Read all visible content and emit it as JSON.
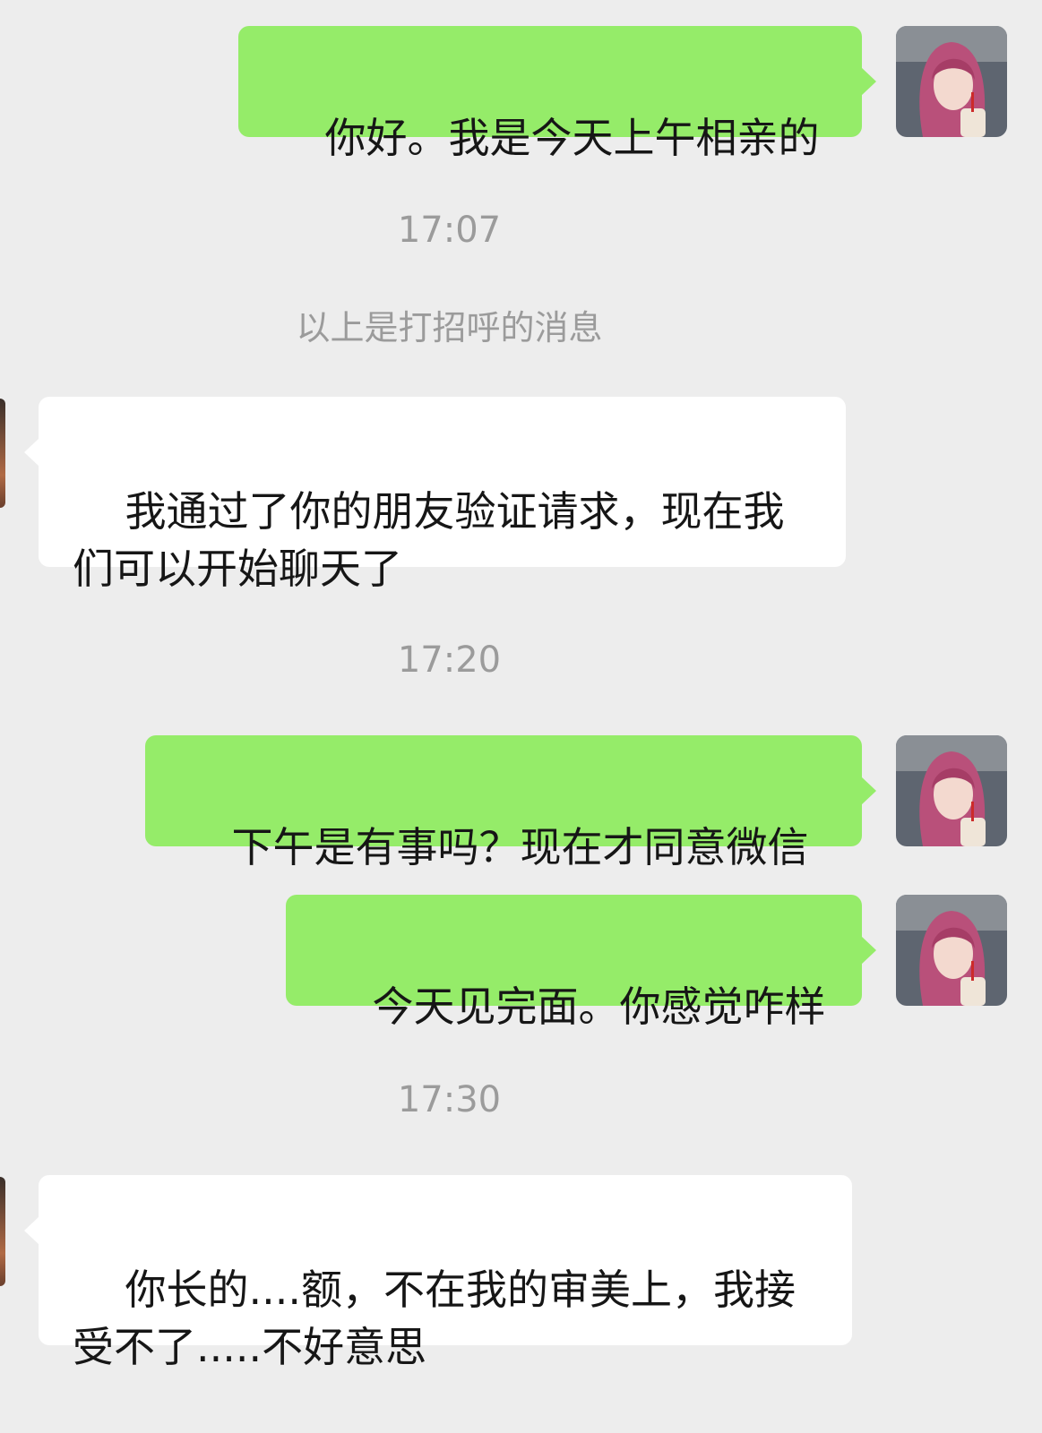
{
  "messages": [
    {
      "text": "你好。我是今天上午相亲的"
    },
    {
      "text": "我通过了你的朋友验证请求，现在我\n们可以开始聊天了"
    },
    {
      "text": "下午是有事吗？现在才同意微信"
    },
    {
      "text": "今天见完面。你感觉咋样"
    },
    {
      "text": "你长的....额，不在我的审美上，我接\n受不了.....不好意思"
    }
  ],
  "timestamps": [
    "17:07",
    "17:20",
    "17:30"
  ],
  "system_note": "以上是打招呼的消息",
  "colors": {
    "background": "#ededed",
    "outgoing_bubble": "#95ec69",
    "incoming_bubble": "#ffffff",
    "muted_text": "#9b9b9b"
  }
}
